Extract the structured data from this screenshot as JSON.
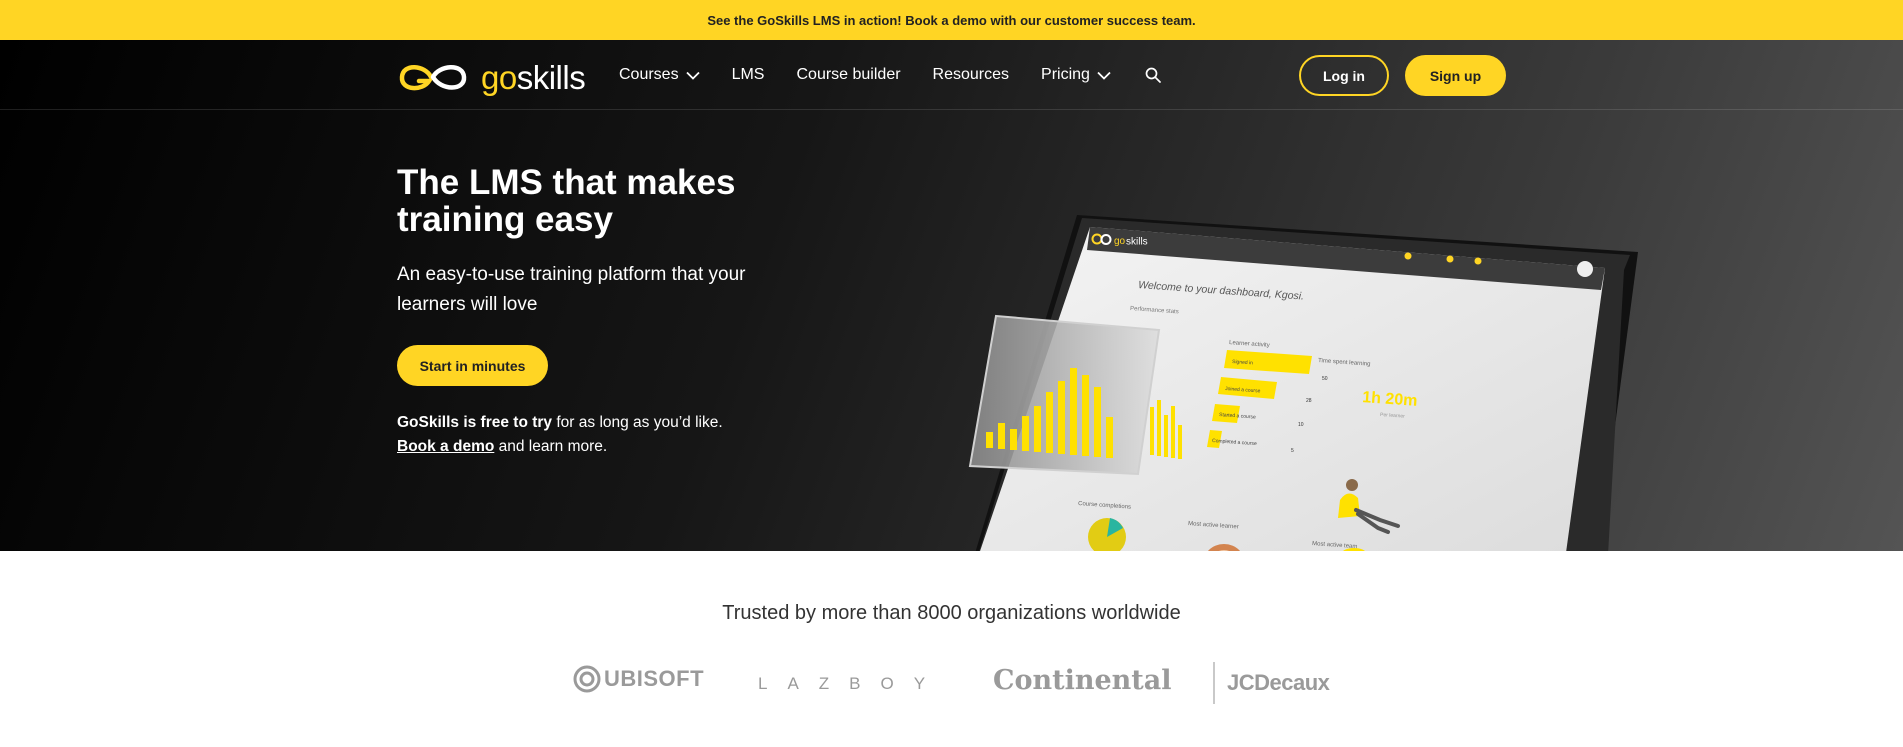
{
  "banner": {
    "text": "See the GoSkills LMS in action! Book a demo with our customer success team."
  },
  "brand": {
    "logo_go": "go",
    "logo_skills": "skills",
    "accent": "#ffd524",
    "dark": "#1a1a1a"
  },
  "nav": {
    "items": [
      {
        "label": "Courses",
        "dropdown": true
      },
      {
        "label": "LMS",
        "dropdown": false
      },
      {
        "label": "Course builder",
        "dropdown": false
      },
      {
        "label": "Resources",
        "dropdown": false
      },
      {
        "label": "Pricing",
        "dropdown": true
      }
    ],
    "search_icon": "search-icon",
    "login": "Log in",
    "signup": "Sign up"
  },
  "hero": {
    "title": "The LMS that makes training easy",
    "subtitle": "An easy-to-use training platform that your learners will love",
    "cta": "Start in minutes",
    "free_strong": "GoSkills is free to try",
    "free_rest": " for as long as you’d like.",
    "demo_link": "Book a demo",
    "demo_rest": " and learn more."
  },
  "dashboard": {
    "logo_go": "go",
    "logo_skills": "skills",
    "welcome": "Welcome to your dashboard, Kgosi.",
    "performance": "Performance stats",
    "learner_activity": "Learner activity",
    "activity_rows": [
      {
        "label": "Signed in",
        "value": 50
      },
      {
        "label": "Joined a course",
        "value": 28
      },
      {
        "label": "Started a course",
        "value": 10
      },
      {
        "label": "Completed a course",
        "value": 5
      }
    ],
    "time_spent": "Time spent learning",
    "time_value": "1h 20m",
    "time_caption": "Per learner",
    "course_completions": "Course completions",
    "most_active_learner": "Most active learner",
    "most_active_team": "Most active team"
  },
  "trusted": {
    "heading": "Trusted by more than 8000 organizations worldwide",
    "logos": [
      "UBISOFT",
      "LAZBOY",
      "Continental",
      "JCDecaux"
    ]
  }
}
